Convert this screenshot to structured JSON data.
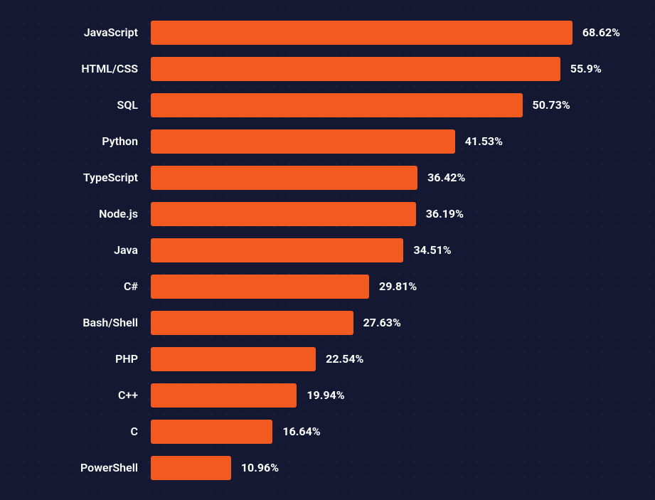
{
  "chart_data": {
    "type": "bar",
    "orientation": "horizontal",
    "xlabel": "",
    "ylabel": "",
    "title": "",
    "xlim": [
      0,
      100
    ],
    "unit": "%",
    "categories": [
      "JavaScript",
      "HTML/CSS",
      "SQL",
      "Python",
      "TypeScript",
      "Node.js",
      "Java",
      "C#",
      "Bash/Shell",
      "PHP",
      "C++",
      "C",
      "PowerShell"
    ],
    "values": [
      68.62,
      55.9,
      50.73,
      41.53,
      36.42,
      36.19,
      34.51,
      29.81,
      27.63,
      22.54,
      19.94,
      16.64,
      10.96
    ],
    "display_values": [
      "68.62%",
      "55.9%",
      "50.73%",
      "41.53%",
      "36.42%",
      "36.19%",
      "34.51%",
      "29.81%",
      "27.63%",
      "22.54%",
      "19.94%",
      "16.64%",
      "10.96%"
    ],
    "bar_color": "#f25a1f",
    "background_color": "#141833"
  }
}
